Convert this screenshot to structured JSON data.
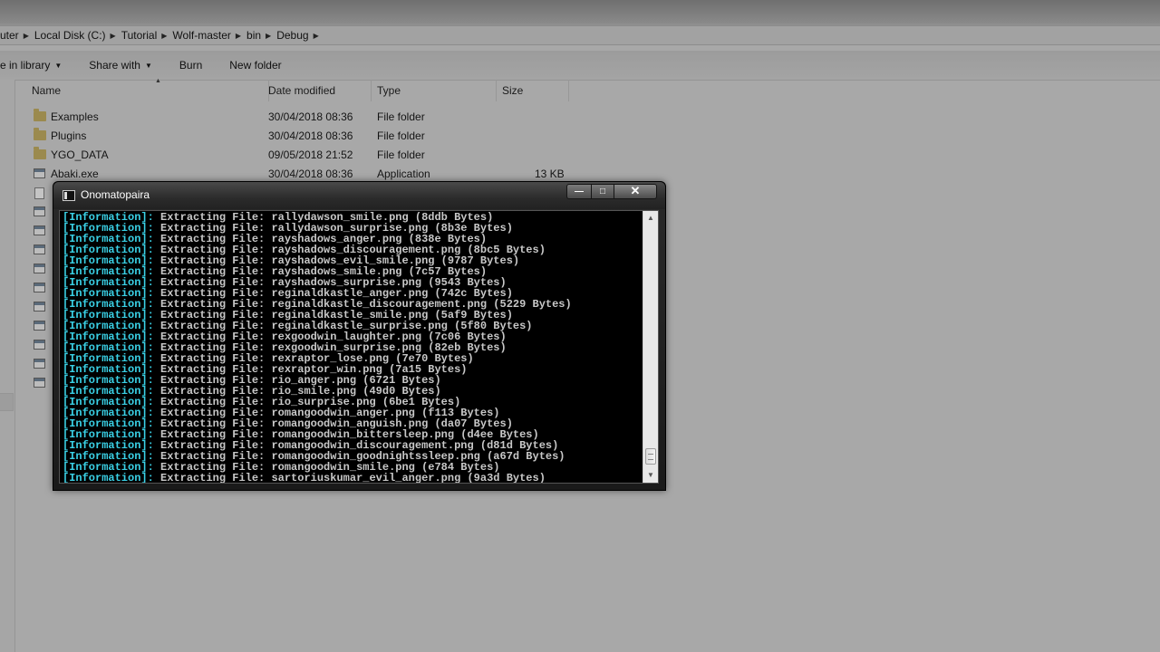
{
  "explorer": {
    "breadcrumbs": [
      "uter",
      "Local Disk (C:)",
      "Tutorial",
      "Wolf-master",
      "bin",
      "Debug"
    ],
    "toolbar": {
      "include_library": "e in library",
      "share_with": "Share with",
      "burn": "Burn",
      "new_folder": "New folder"
    },
    "columns": {
      "name": "Name",
      "date_modified": "Date modified",
      "type": "Type",
      "size": "Size"
    },
    "files": [
      {
        "name": "Examples",
        "date": "30/04/2018 08:36",
        "type": "File folder",
        "size": "",
        "icon": "folder-icon"
      },
      {
        "name": "Plugins",
        "date": "30/04/2018 08:36",
        "type": "File folder",
        "size": "",
        "icon": "folder-icon"
      },
      {
        "name": "YGO_DATA",
        "date": "09/05/2018 21:52",
        "type": "File folder",
        "size": "",
        "icon": "folder-icon"
      },
      {
        "name": "Abaki.exe",
        "date": "30/04/2018 08:36",
        "type": "Application",
        "size": "13 KB",
        "icon": "application-icon"
      }
    ]
  },
  "console": {
    "title": "Onomatopaira",
    "buttons": {
      "minimize": "—",
      "maximize": "□",
      "close": "✕"
    },
    "tag": "[Information]:",
    "lines": [
      " Extracting File: rallydawson_smile.png (8ddb Bytes)",
      " Extracting File: rallydawson_surprise.png (8b3e Bytes)",
      " Extracting File: rayshadows_anger.png (838e Bytes)",
      " Extracting File: rayshadows_discouragement.png (8bc5 Bytes)",
      " Extracting File: rayshadows_evil_smile.png (9787 Bytes)",
      " Extracting File: rayshadows_smile.png (7c57 Bytes)",
      " Extracting File: rayshadows_surprise.png (9543 Bytes)",
      " Extracting File: reginaldkastle_anger.png (742c Bytes)",
      " Extracting File: reginaldkastle_discouragement.png (5229 Bytes)",
      " Extracting File: reginaldkastle_smile.png (5af9 Bytes)",
      " Extracting File: reginaldkastle_surprise.png (5f80 Bytes)",
      " Extracting File: rexgoodwin_laughter.png (7c06 Bytes)",
      " Extracting File: rexgoodwin_surprise.png (82eb Bytes)",
      " Extracting File: rexraptor_lose.png (7e70 Bytes)",
      " Extracting File: rexraptor_win.png (7a15 Bytes)",
      " Extracting File: rio_anger.png (6721 Bytes)",
      " Extracting File: rio_smile.png (49d0 Bytes)",
      " Extracting File: rio_surprise.png (6be1 Bytes)",
      " Extracting File: romangoodwin_anger.png (f113 Bytes)",
      " Extracting File: romangoodwin_anguish.png (da07 Bytes)",
      " Extracting File: romangoodwin_bittersleep.png (d4ee Bytes)",
      " Extracting File: romangoodwin_discouragement.png (d81d Bytes)",
      " Extracting File: romangoodwin_goodnightssleep.png (a67d Bytes)",
      " Extracting File: romangoodwin_smile.png (e784 Bytes)",
      " Extracting File: sartoriuskumar_evil_anger.png (9a3d Bytes)"
    ]
  },
  "colors": {
    "console_tag": "#3ad1e6",
    "console_text": "#c8c8c8",
    "console_bg": "#000000"
  }
}
